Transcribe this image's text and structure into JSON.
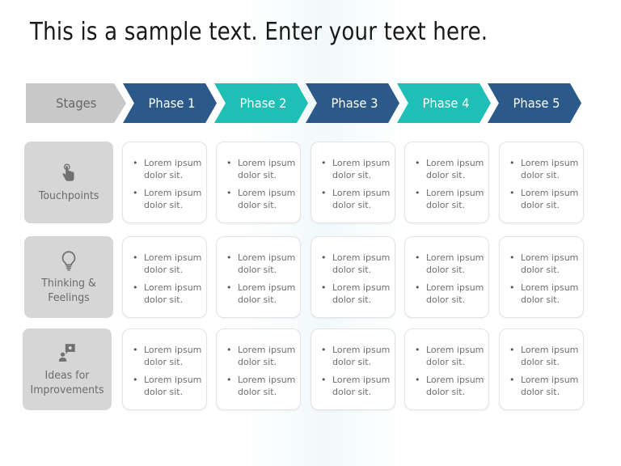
{
  "title": "This is a sample text. Enter your text here.",
  "header": {
    "stages_label": "Stages",
    "phases": [
      {
        "label": "Phase 1",
        "color": "#2b5a8a"
      },
      {
        "label": "Phase 2",
        "color": "#1fbfb6"
      },
      {
        "label": "Phase 3",
        "color": "#2b5a8a"
      },
      {
        "label": "Phase 4",
        "color": "#1fbfb6"
      },
      {
        "label": "Phase 5",
        "color": "#2b5a8a"
      }
    ]
  },
  "rows": [
    {
      "label": "Touchpoints",
      "icon": "touch-hand-icon",
      "cells": [
        [
          "Lorem ipsum dolor sit.",
          "Lorem ipsum dolor sit."
        ],
        [
          "Lorem ipsum dolor sit.",
          "Lorem ipsum dolor sit."
        ],
        [
          "Lorem ipsum dolor sit.",
          "Lorem ipsum dolor sit."
        ],
        [
          "Lorem ipsum dolor sit.",
          "Lorem ipsum dolor sit."
        ],
        [
          "Lorem ipsum dolor sit.",
          "Lorem ipsum dolor sit."
        ]
      ]
    },
    {
      "label": "Thinking & Feelings",
      "icon": "lightbulb-icon",
      "cells": [
        [
          "Lorem ipsum dolor sit.",
          "Lorem ipsum dolor sit."
        ],
        [
          "Lorem ipsum dolor sit.",
          "Lorem ipsum dolor sit."
        ],
        [
          "Lorem ipsum dolor sit.",
          "Lorem ipsum dolor sit."
        ],
        [
          "Lorem ipsum dolor sit.",
          "Lorem ipsum dolor sit."
        ],
        [
          "Lorem ipsum dolor sit.",
          "Lorem ipsum dolor sit."
        ]
      ]
    },
    {
      "label": "Ideas for Improvements",
      "icon": "person-idea-icon",
      "cells": [
        [
          "Lorem ipsum dolor sit.",
          "Lorem ipsum dolor sit."
        ],
        [
          "Lorem ipsum dolor sit.",
          "Lorem ipsum dolor sit."
        ],
        [
          "Lorem ipsum dolor sit.",
          "Lorem ipsum dolor sit."
        ],
        [
          "Lorem ipsum dolor sit.",
          "Lorem ipsum dolor sit."
        ],
        [
          "Lorem ipsum dolor sit.",
          "Lorem ipsum dolor sit."
        ]
      ]
    }
  ]
}
